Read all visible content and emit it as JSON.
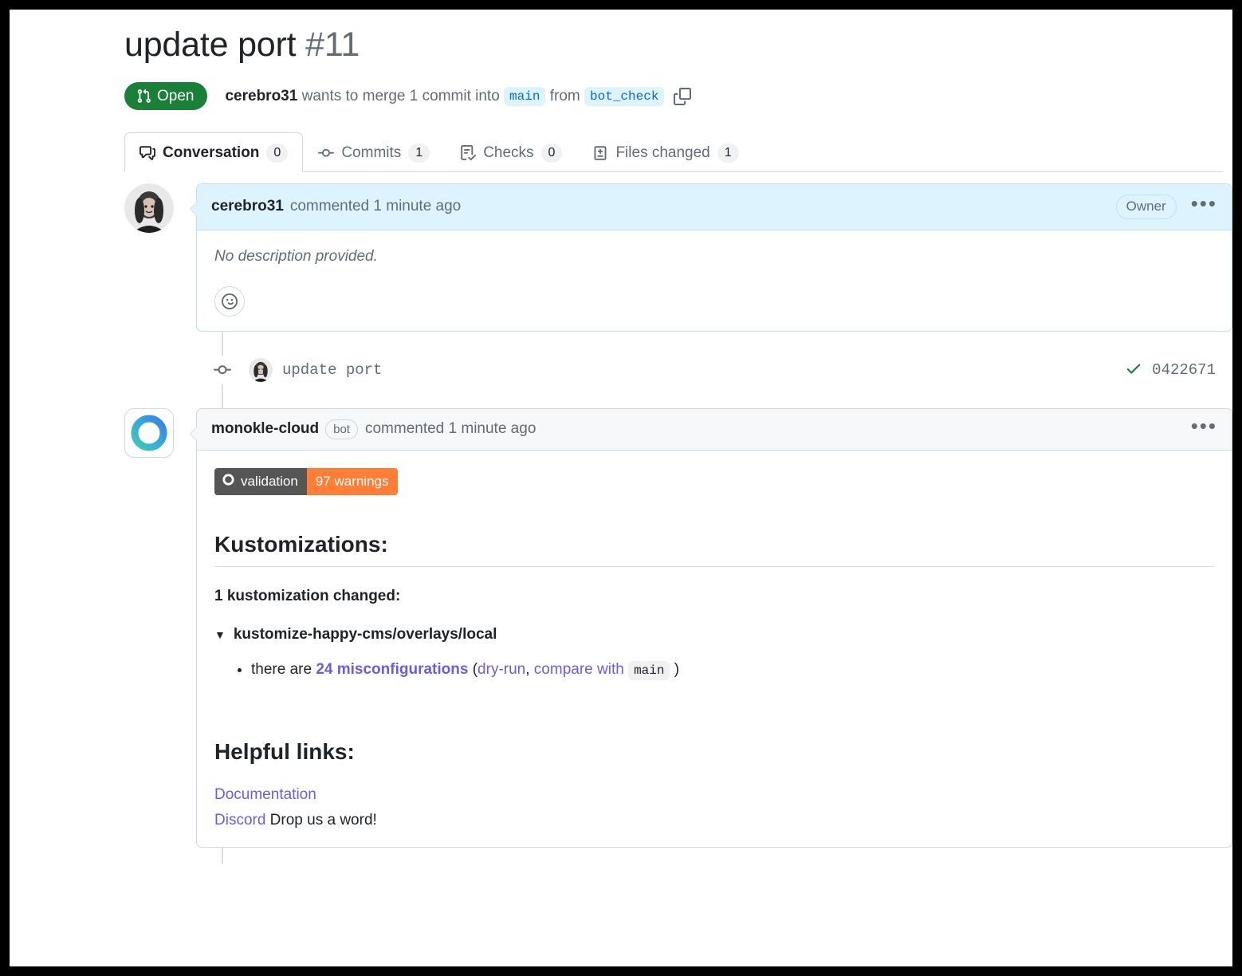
{
  "header": {
    "title": "update port",
    "number": "#11",
    "state_label": "Open",
    "state_icon": "git-pull-request-icon",
    "state_color": "#1a7f37",
    "author": "cerebro31",
    "merge_text_1": " wants to merge 1 commit into ",
    "base_branch": "main",
    "merge_text_2": " from ",
    "head_branch": "bot_check",
    "copy_icon": "copy-icon"
  },
  "tabs": [
    {
      "label": "Conversation",
      "count": "0",
      "icon": "comment-discussion-icon",
      "selected": true
    },
    {
      "label": "Commits",
      "count": "1",
      "icon": "git-commit-icon",
      "selected": false
    },
    {
      "label": "Checks",
      "count": "0",
      "icon": "checklist-icon",
      "selected": false
    },
    {
      "label": "Files changed",
      "count": "1",
      "icon": "file-diff-icon",
      "selected": false
    }
  ],
  "comments": [
    {
      "author": "cerebro31",
      "meta": "commented 1 minute ago",
      "role_badge": "Owner",
      "body_text": "No description provided.",
      "menu_icon": "kebab-horizontal-icon",
      "reaction_icon": "smiley-icon"
    },
    {
      "author": "monokle-cloud",
      "tag": "bot",
      "meta": "commented 1 minute ago",
      "menu_icon": "kebab-horizontal-icon",
      "shield": {
        "left_label": "validation",
        "right_label": "97 warnings",
        "left_color": "#555555",
        "right_color": "#fe7d37",
        "icon": "monokle-ring-icon"
      },
      "sections": {
        "kustomizations_heading": "Kustomizations:",
        "changed_summary": "1 kustomization changed:",
        "kustomization_name": "kustomize-happy-cms/overlays/local",
        "bullet": {
          "prefix": "there are ",
          "link_text": "24 misconfigurations",
          "paren_open": " (",
          "dry_run_link": "dry-run",
          "comma": ", ",
          "compare_link": "compare with",
          "branch_code": "main",
          "paren_close": ")"
        },
        "helpful_heading": "Helpful links:",
        "documentation_link": "Documentation",
        "discord_link": "Discord",
        "discord_suffix": " Drop us a word!"
      }
    }
  ],
  "commit_row": {
    "message": "update port",
    "sha": "0422671",
    "status_icon": "check-icon",
    "status_color": "#1a7f37",
    "node_icon": "git-commit-icon"
  }
}
